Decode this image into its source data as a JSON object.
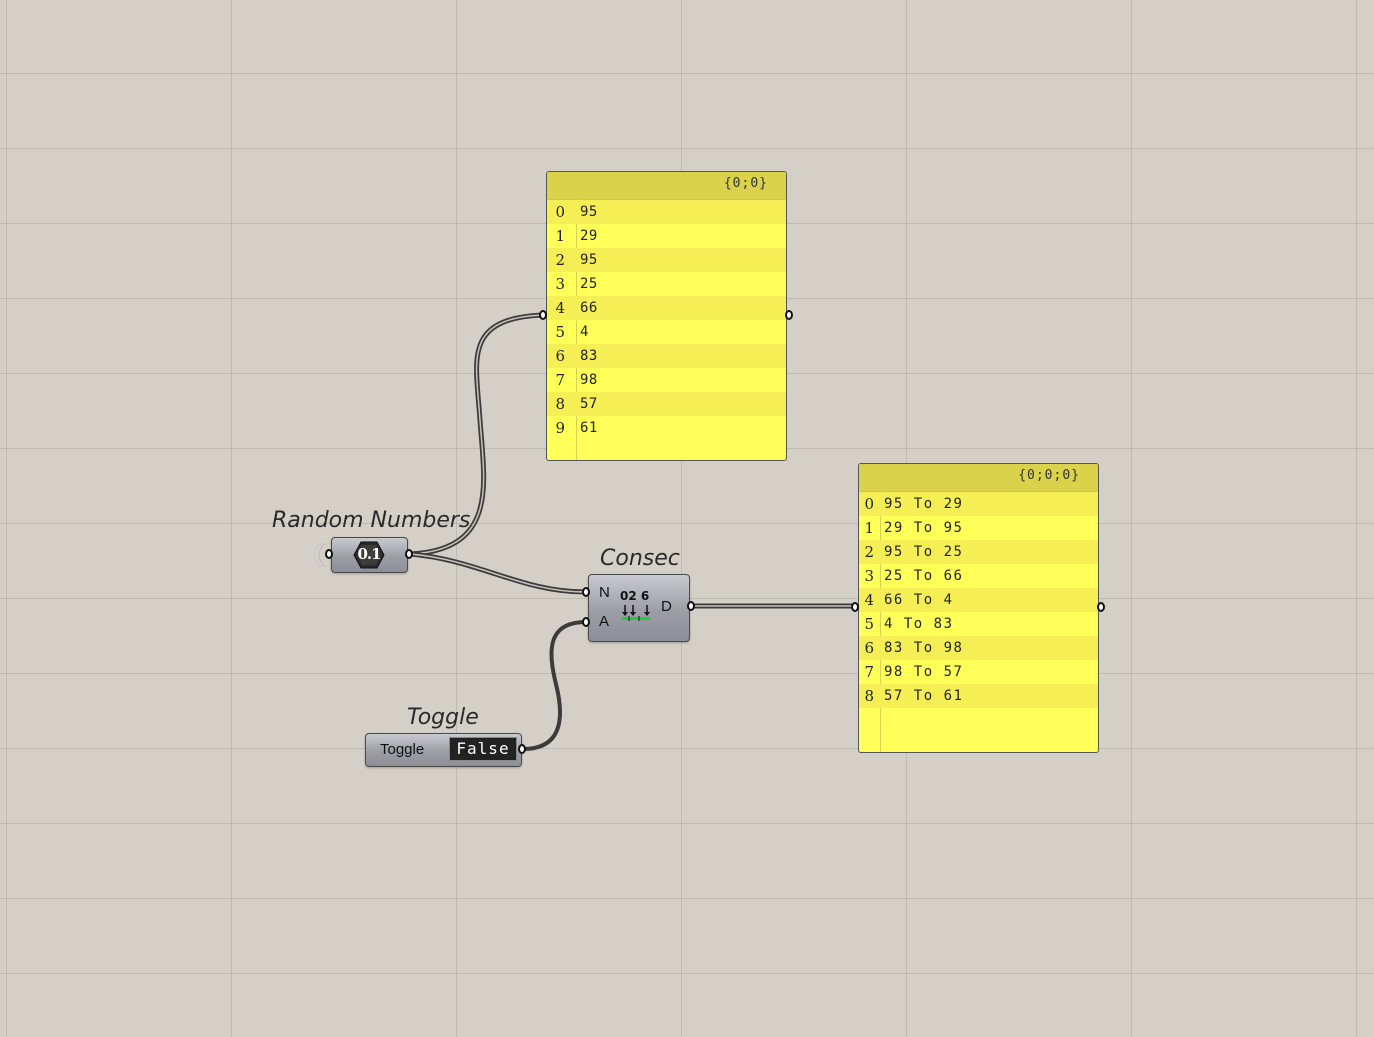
{
  "canvas": {
    "background": "#d4d0c8",
    "wire_color": "#3c3c3c",
    "panel_color": "#ffff5a"
  },
  "random_numbers": {
    "title": "Random Numbers",
    "icon_text": "0.1",
    "icon": "random-numbers-icon"
  },
  "consec": {
    "title": "Consec",
    "input_n": "N",
    "input_a": "A",
    "output_d": "D",
    "icon_digits": "02 6",
    "icon": "consecutive-pairs-icon"
  },
  "toggle": {
    "title": "Toggle",
    "label": "Toggle",
    "value": "False"
  },
  "panel_numbers": {
    "path": "{0;0}",
    "rows": [
      {
        "index": "0",
        "value": "95"
      },
      {
        "index": "1",
        "value": "29"
      },
      {
        "index": "2",
        "value": "95"
      },
      {
        "index": "3",
        "value": "25"
      },
      {
        "index": "4",
        "value": "66"
      },
      {
        "index": "5",
        "value": "4"
      },
      {
        "index": "6",
        "value": "83"
      },
      {
        "index": "7",
        "value": "98"
      },
      {
        "index": "8",
        "value": "57"
      },
      {
        "index": "9",
        "value": "61"
      }
    ]
  },
  "panel_pairs": {
    "path": "{0;0;0}",
    "rows": [
      {
        "index": "0",
        "value": "95 To 29"
      },
      {
        "index": "1",
        "value": "29 To 95"
      },
      {
        "index": "2",
        "value": "95 To 25"
      },
      {
        "index": "3",
        "value": "25 To 66"
      },
      {
        "index": "4",
        "value": "66 To 4"
      },
      {
        "index": "5",
        "value": "4 To 83"
      },
      {
        "index": "6",
        "value": "83 To 98"
      },
      {
        "index": "7",
        "value": "98 To 57"
      },
      {
        "index": "8",
        "value": "57 To 61"
      }
    ]
  }
}
